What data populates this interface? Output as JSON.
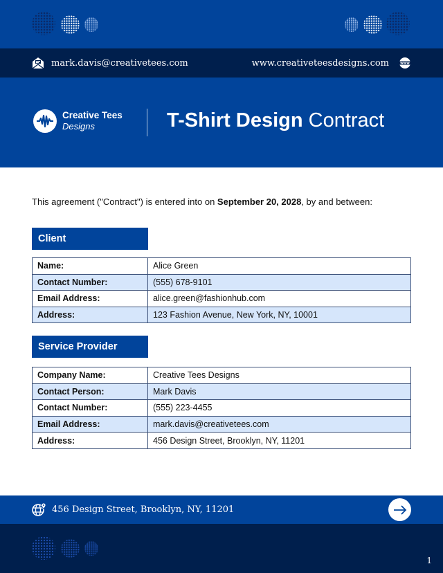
{
  "header": {
    "email": "mark.davis@creativetees.com",
    "website": "www.creativeteesdesigns.com",
    "email_icon": "envelope-open-icon",
    "website_icon": "www-globe-icon"
  },
  "hero": {
    "logo_line1": "Creative Tees",
    "logo_line2": "Designs",
    "logo_icon": "soundwave-icon",
    "title_bold": "T-Shirt Design",
    "title_light": "Contract"
  },
  "intro": {
    "before": "This agreement (\"Contract\") is entered into on ",
    "date": "September 20, 2028",
    "after": ", by and between:"
  },
  "client": {
    "heading": "Client",
    "rows": [
      {
        "label": "Name:",
        "value": "Alice Green"
      },
      {
        "label": "Contact Number:",
        "value": "(555) 678-9101"
      },
      {
        "label": "Email Address:",
        "value": "alice.green@fashionhub.com"
      },
      {
        "label": "Address:",
        "value": "123 Fashion Avenue, New York, NY, 10001"
      }
    ]
  },
  "provider": {
    "heading": "Service Provider",
    "rows": [
      {
        "label": "Company Name:",
        "value": "Creative Tees Designs"
      },
      {
        "label": "Contact Person:",
        "value": "Mark Davis"
      },
      {
        "label": "Contact Number:",
        "value": "(555) 223-4455"
      },
      {
        "label": "Email Address:",
        "value": "mark.davis@creativetees.com"
      },
      {
        "label": "Address:",
        "value": "456 Design Street, Brooklyn, NY, 11201"
      }
    ]
  },
  "footer": {
    "address": "456 Design Street, Brooklyn, NY, 11201",
    "address_icon": "globe-pin-icon",
    "next_icon": "arrow-right-icon",
    "page_number": "1"
  },
  "colors": {
    "primary": "#01449b",
    "dark": "#001f4d",
    "row_alt": "#d6e6fb"
  }
}
